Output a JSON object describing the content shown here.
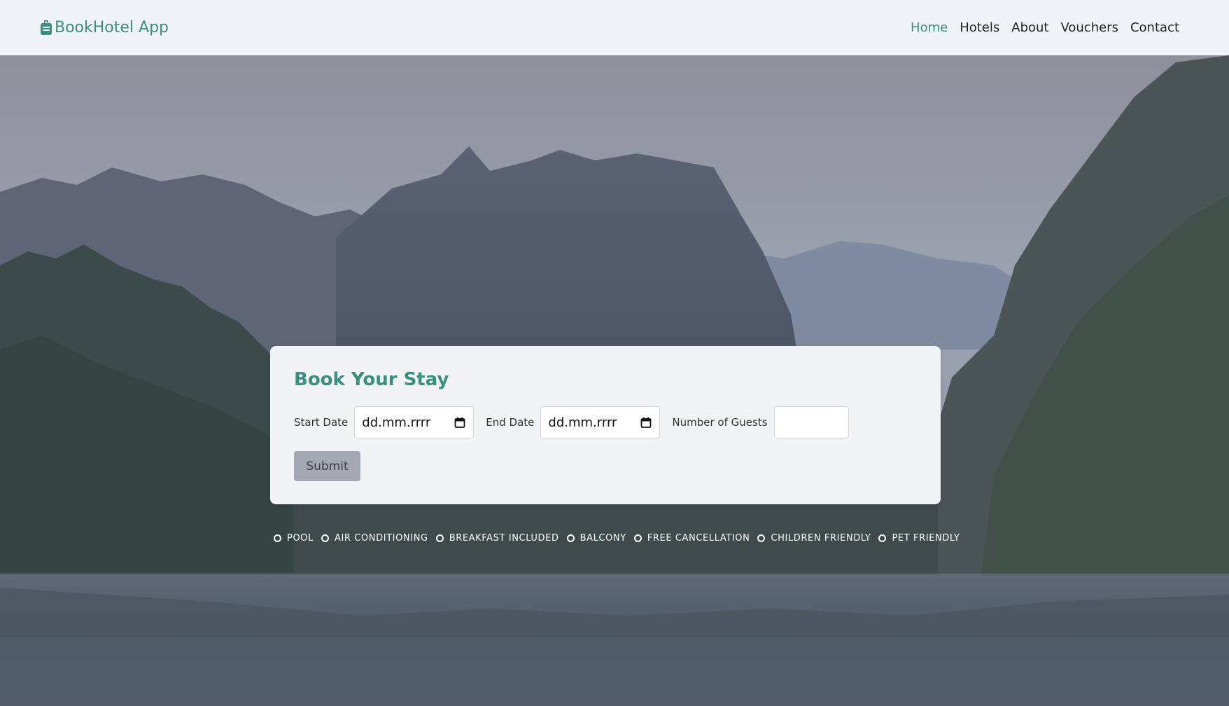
{
  "header": {
    "brand": "BookHotel App",
    "nav": [
      {
        "label": "Home",
        "active": true
      },
      {
        "label": "Hotels",
        "active": false
      },
      {
        "label": "About",
        "active": false
      },
      {
        "label": "Vouchers",
        "active": false
      },
      {
        "label": "Contact",
        "active": false
      }
    ]
  },
  "booking": {
    "title": "Book Your Stay",
    "start_label": "Start Date",
    "start_value": "dd.mm.rrrr",
    "end_label": "End Date",
    "end_value": "dd.mm.rrrr",
    "guests_label": "Number of Guests",
    "guests_value": "",
    "submit_label": "Submit"
  },
  "amenities": [
    "POOL",
    "AIR CONDITIONING",
    "BREAKFAST INCLUDED",
    "BALCONY",
    "FREE CANCELLATION",
    "CHILDREN FRIENDLY",
    "PET FRIENDLY"
  ],
  "colors": {
    "accent": "#3a8f7f",
    "header_bg": "#f0f3f8",
    "card_bg": "#f2f3f5",
    "button_bg": "#a3a8b2"
  },
  "icons": {
    "brand": "suitcase-icon",
    "date": "calendar-icon"
  }
}
